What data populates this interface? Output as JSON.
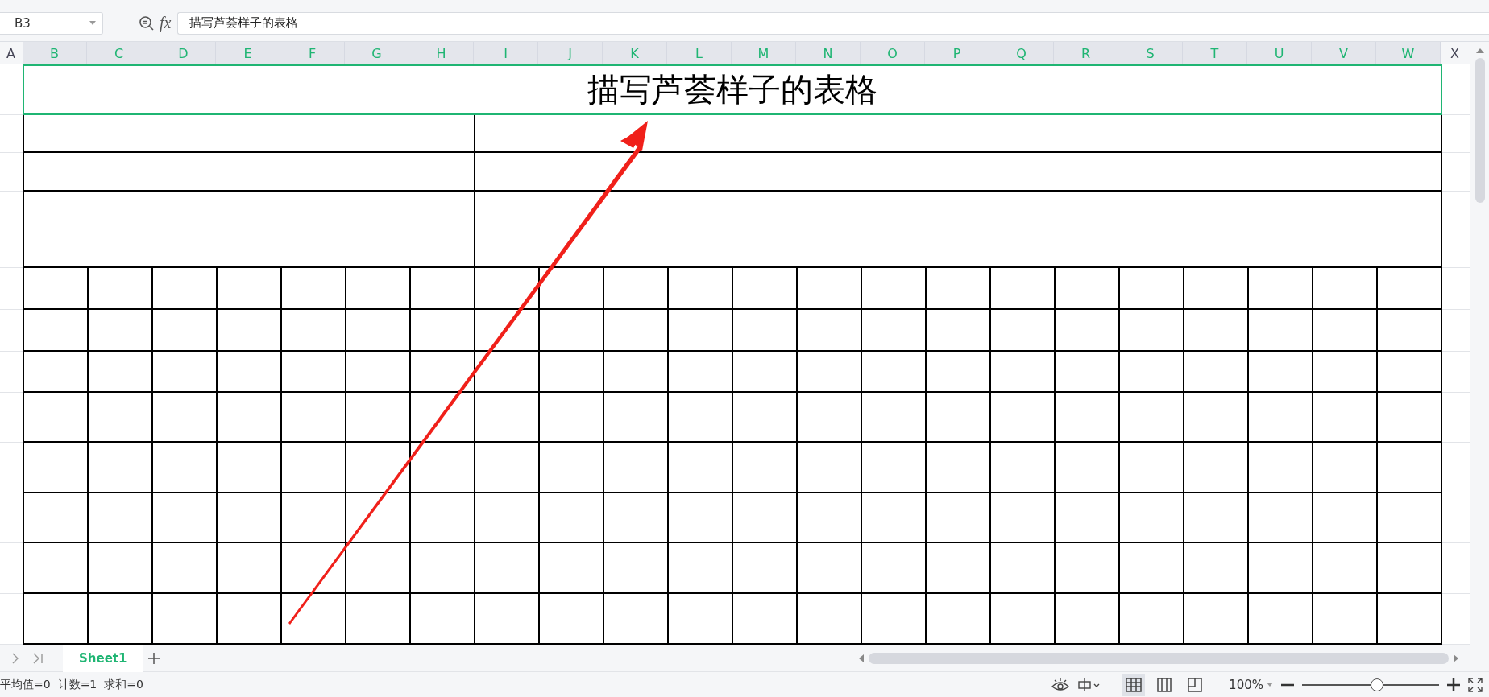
{
  "name_box": {
    "value": "B3"
  },
  "formula_bar": {
    "fx_label": "fx",
    "value": "描写芦荟样子的表格"
  },
  "columns": [
    {
      "label": "A",
      "selected": false
    },
    {
      "label": "B",
      "selected": true
    },
    {
      "label": "C",
      "selected": true
    },
    {
      "label": "D",
      "selected": true
    },
    {
      "label": "E",
      "selected": true
    },
    {
      "label": "F",
      "selected": true
    },
    {
      "label": "G",
      "selected": true
    },
    {
      "label": "H",
      "selected": true
    },
    {
      "label": "I",
      "selected": true
    },
    {
      "label": "J",
      "selected": true
    },
    {
      "label": "K",
      "selected": true
    },
    {
      "label": "L",
      "selected": true
    },
    {
      "label": "M",
      "selected": true
    },
    {
      "label": "N",
      "selected": true
    },
    {
      "label": "O",
      "selected": true
    },
    {
      "label": "P",
      "selected": true
    },
    {
      "label": "Q",
      "selected": true
    },
    {
      "label": "R",
      "selected": true
    },
    {
      "label": "S",
      "selected": true
    },
    {
      "label": "T",
      "selected": true
    },
    {
      "label": "U",
      "selected": true
    },
    {
      "label": "V",
      "selected": true
    },
    {
      "label": "W",
      "selected": true
    },
    {
      "label": "X",
      "selected": false
    }
  ],
  "sheet": {
    "title": "描写芦荟样子的表格",
    "title_selected": true
  },
  "sheet_tabs": [
    {
      "label": "Sheet1",
      "selected": true
    }
  ],
  "status_bar": {
    "stats": [
      "平均值=0",
      "计数=1",
      "求和=0"
    ],
    "views": [
      {
        "kind": "normal",
        "selected": true
      },
      {
        "kind": "reading",
        "selected": false
      },
      {
        "kind": "page",
        "selected": false
      }
    ],
    "zoom": "100%",
    "zoom_slider": {
      "level": 0.55
    }
  }
}
